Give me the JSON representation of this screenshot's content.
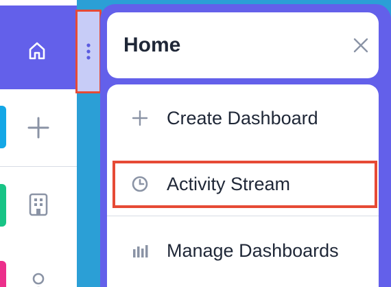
{
  "panel": {
    "title": "Home",
    "items": [
      {
        "label": "Create Dashboard",
        "icon": "plus-icon"
      },
      {
        "label": "Activity Stream",
        "icon": "clock-icon"
      },
      {
        "label": "Manage Dashboards",
        "icon": "bar-chart-icon"
      }
    ]
  },
  "colors": {
    "accent": "#6360ea",
    "background": "#2b9fd6",
    "highlight": "#e64a35",
    "text": "#1f2737"
  },
  "icons": {
    "home": "home-icon",
    "create": "plus-icon",
    "accounts": "building-icon",
    "contacts": "person-icon",
    "kebab": "kebab-vertical-icon",
    "close": "close-icon"
  }
}
